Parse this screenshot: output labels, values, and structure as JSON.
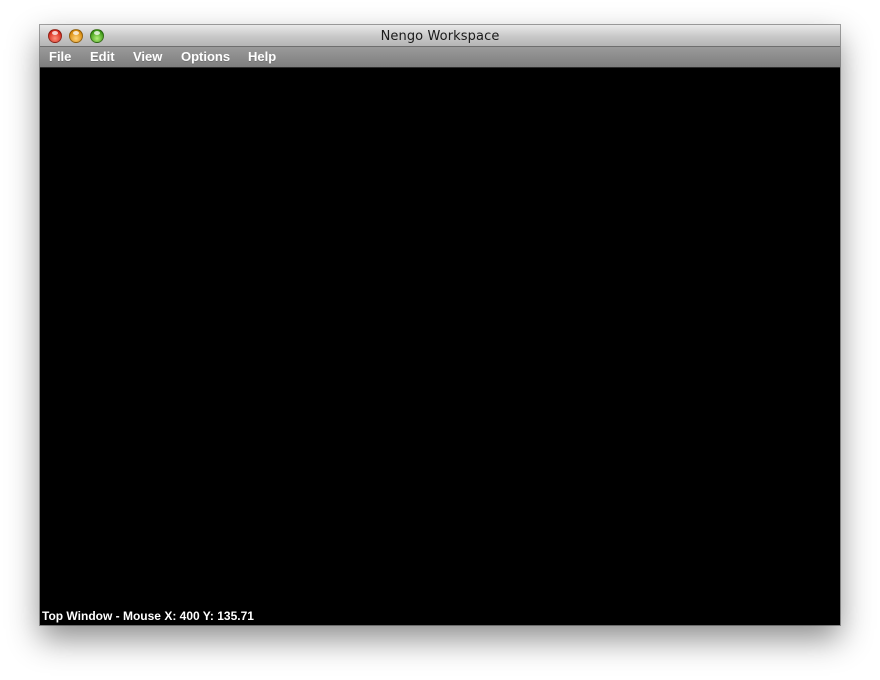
{
  "window": {
    "title": "Nengo Workspace",
    "controls": [
      "close-button",
      "minimize-button",
      "zoom-button"
    ]
  },
  "menubar": {
    "items": [
      {
        "label": "File"
      },
      {
        "label": "Edit"
      },
      {
        "label": "View"
      },
      {
        "label": "Options"
      },
      {
        "label": "Help"
      }
    ]
  },
  "workspace": {
    "background": "#000000",
    "status_text": "Top Window - Mouse X: 400 Y: 135.71"
  },
  "colors": {
    "close": "#d52a1c",
    "minimize": "#d98b0c",
    "zoom": "#3e9a17"
  }
}
